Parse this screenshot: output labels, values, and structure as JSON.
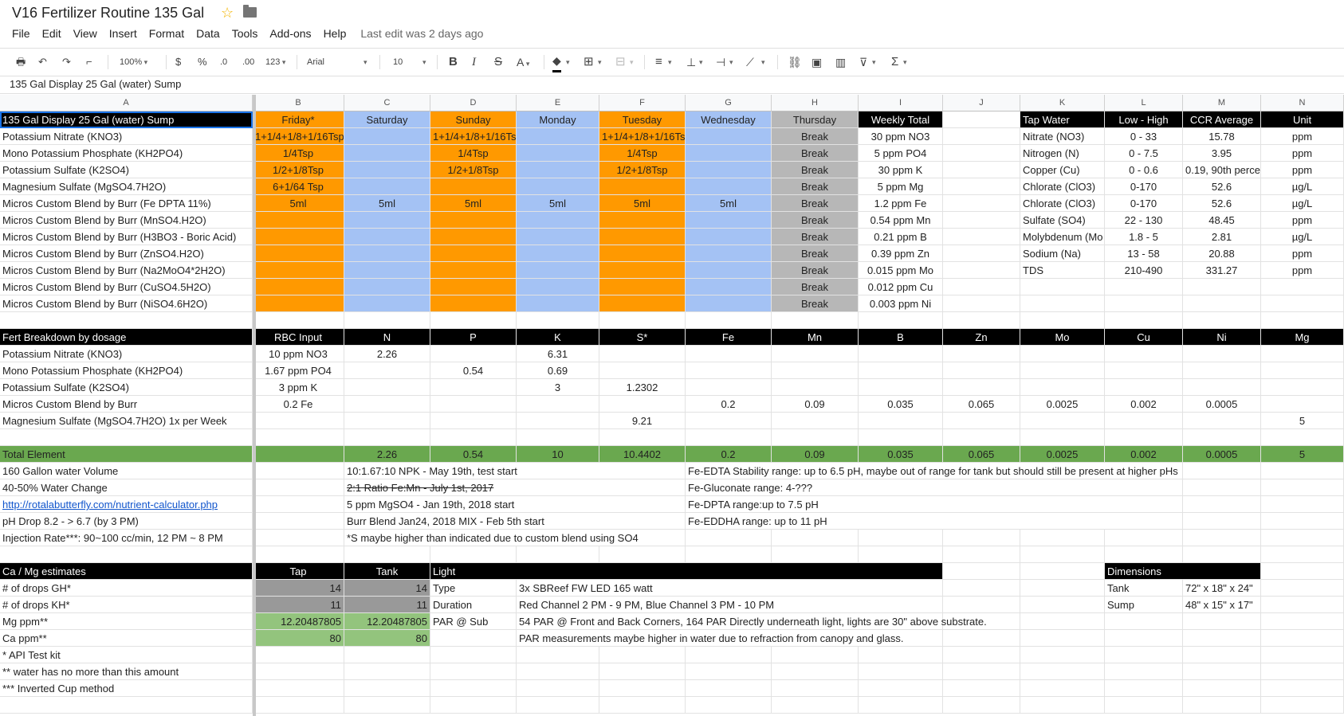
{
  "doc": {
    "title": "V16 Fertilizer Routine 135 Gal",
    "last_edit": "Last edit was 2 days ago"
  },
  "menu": [
    "File",
    "Edit",
    "View",
    "Insert",
    "Format",
    "Data",
    "Tools",
    "Add-ons",
    "Help"
  ],
  "toolbar": {
    "zoom": "100%",
    "currency": "$",
    "percent": "%",
    "dec_less": ".0",
    "dec_more": ".00",
    "format_more": "123",
    "font": "Arial",
    "font_size": "10"
  },
  "formula_bar": "135 Gal Display 25 Gal (water)  Sump",
  "columns": [
    "A",
    "B",
    "C",
    "D",
    "E",
    "F",
    "G",
    "H",
    "I",
    "J",
    "K",
    "L",
    "M",
    "N"
  ],
  "sched": {
    "header": [
      "135 Gal Display 25 Gal (water)  Sump",
      "Friday*",
      "Saturday",
      "Sunday",
      "Monday",
      "Tuesday",
      "Wednesday",
      "Thursday",
      "Weekly Total"
    ],
    "rows": [
      [
        "Potassium Nitrate (KNO3)",
        "1+1/4+1/8+1/16Tsp",
        "",
        "1+1/4+1/8+1/16Tsp",
        "",
        "1+1/4+1/8+1/16Tsp",
        "",
        "Break",
        "30 ppm NO3"
      ],
      [
        "Mono Potassium Phosphate (KH2PO4)",
        "1/4Tsp",
        "",
        "1/4Tsp",
        "",
        "1/4Tsp",
        "",
        "Break",
        "5 ppm PO4"
      ],
      [
        "Potassium Sulfate (K2SO4)",
        "1/2+1/8Tsp",
        "",
        "1/2+1/8Tsp",
        "",
        "1/2+1/8Tsp",
        "",
        "Break",
        "30 ppm K"
      ],
      [
        "Magnesium Sulfate (MgSO4.7H2O)",
        "6+1/64 Tsp",
        "",
        "",
        "",
        "",
        "",
        "Break",
        "5 ppm Mg"
      ],
      [
        "Micros Custom Blend by Burr (Fe DPTA 11%)",
        "5ml",
        "5ml",
        "5ml",
        "5ml",
        "5ml",
        "5ml",
        "Break",
        "1.2 ppm Fe"
      ],
      [
        "Micros Custom Blend by Burr (MnSO4.H2O)",
        "",
        "",
        "",
        "",
        "",
        "",
        "Break",
        "0.54 ppm Mn"
      ],
      [
        "Micros Custom Blend by Burr (H3BO3 - Boric Acid)",
        "",
        "",
        "",
        "",
        "",
        "",
        "Break",
        "0.21 ppm B"
      ],
      [
        "Micros Custom Blend by Burr (ZnSO4.H2O)",
        "",
        "",
        "",
        "",
        "",
        "",
        "Break",
        "0.39 ppm Zn"
      ],
      [
        "Micros Custom Blend by Burr (Na2MoO4*2H2O)",
        "",
        "",
        "",
        "",
        "",
        "",
        "Break",
        "0.015 ppm Mo"
      ],
      [
        "Micros Custom Blend by Burr (CuSO4.5H2O)",
        "",
        "",
        "",
        "",
        "",
        "",
        "Break",
        "0.012 ppm Cu"
      ],
      [
        "Micros Custom Blend by Burr (NiSO4.6H2O)",
        "",
        "",
        "",
        "",
        "",
        "",
        "Break",
        "0.003 ppm Ni"
      ]
    ]
  },
  "tap": {
    "header": [
      "Tap Water",
      "Low - High",
      "CCR Average",
      "Unit"
    ],
    "rows": [
      [
        "Nitrate (NO3)",
        "0 - 33",
        "15.78",
        "ppm"
      ],
      [
        "Nitrogen (N)",
        "0 - 7.5",
        "3.95",
        "ppm"
      ],
      [
        "Copper (Cu)",
        "0 - 0.6",
        "0.19, 90th percer",
        "ppm"
      ],
      [
        "Chlorate (ClO3)",
        "0-170",
        "52.6",
        "µg/L"
      ],
      [
        "Chlorate (ClO3)",
        "0-170",
        "52.6",
        "µg/L"
      ],
      [
        "Sulfate (SO4)",
        "22 - 130",
        "48.45",
        "ppm"
      ],
      [
        "Molybdenum (Mo",
        "1.8 - 5",
        "2.81",
        "µg/L"
      ],
      [
        "Sodium (Na)",
        "13 - 58",
        "20.88",
        "ppm"
      ],
      [
        "TDS",
        "210-490",
        "331.27",
        "ppm"
      ]
    ]
  },
  "fert": {
    "header": [
      "Fert Breakdown by dosage",
      "RBC Input",
      "N",
      "P",
      "K",
      "S*",
      "Fe",
      "Mn",
      "B",
      "Zn",
      "Mo",
      "Cu",
      "Ni",
      "Mg"
    ],
    "rows": [
      [
        "Potassium Nitrate (KNO3)",
        "10 ppm NO3",
        "2.26",
        "",
        "6.31",
        "",
        "",
        "",
        "",
        "",
        "",
        "",
        "",
        ""
      ],
      [
        "Mono Potassium Phosphate (KH2PO4)",
        "1.67 ppm PO4",
        "",
        "0.54",
        "0.69",
        "",
        "",
        "",
        "",
        "",
        "",
        "",
        "",
        ""
      ],
      [
        "Potassium Sulfate (K2SO4)",
        "3 ppm K",
        "",
        "",
        "3",
        "1.2302",
        "",
        "",
        "",
        "",
        "",
        "",
        "",
        ""
      ],
      [
        "Micros Custom Blend by Burr",
        "0.2 Fe",
        "",
        "",
        "",
        "",
        "0.2",
        "0.09",
        "0.035",
        "0.065",
        "0.0025",
        "0.002",
        "0.0005",
        ""
      ],
      [
        "Magnesium Sulfate (MgSO4.7H2O) 1x per Week",
        "",
        "",
        "",
        "",
        "9.21",
        "",
        "",
        "",
        "",
        "",
        "",
        "",
        "5"
      ]
    ],
    "total": [
      "Total Element",
      "",
      "2.26",
      "0.54",
      "10",
      "10.4402",
      "0.2",
      "0.09",
      "0.035",
      "0.065",
      "0.0025",
      "0.002",
      "0.0005",
      "5"
    ]
  },
  "notes": {
    "a": [
      "160 Gallon water Volume",
      "40-50% Water Change",
      "http://rotalabutterfly.com/nutrient-calculator.php",
      "pH Drop 8.2 - > 6.7 (by 3 PM)",
      "Injection Rate***: 90~100 cc/min, 12 PM ~ 8 PM"
    ],
    "c": [
      "10:1.67:10 NPK - May 19th, test start",
      "2:1 Ratio Fe:Mn - July 1st, 2017",
      "5 ppm MgSO4 - Jan 19th, 2018 start",
      "Burr Blend Jan24, 2018 MIX - Feb 5th start",
      "*S maybe higher than indicated due to custom blend using SO4"
    ],
    "g": [
      "Fe-EDTA Stability range: up to 6.5 pH, maybe out of range for tank but should still be present at higher pHs",
      "Fe-Gluconate range: 4-???",
      "Fe-DPTA range:up to 7.5 pH",
      "Fe-EDDHA  range: up to 11 pH"
    ]
  },
  "camg": {
    "header": [
      "Ca / Mg estimates",
      "Tap",
      "Tank"
    ],
    "rows": [
      [
        "# of drops GH*",
        "14",
        "14"
      ],
      [
        "# of drops KH*",
        "11",
        "11"
      ],
      [
        "Mg ppm**",
        "12.20487805",
        "12.20487805"
      ],
      [
        "Ca ppm**",
        "80",
        "80"
      ],
      [
        "* API Test kit",
        "",
        ""
      ],
      [
        "** water has no more than this amount",
        "",
        ""
      ],
      [
        "*** Inverted Cup method",
        "",
        ""
      ]
    ]
  },
  "light": {
    "header": "Light",
    "rows": [
      [
        "Type",
        "3x SBReef FW LED 165 watt"
      ],
      [
        "Duration",
        "Red Channel 2 PM - 9 PM, Blue Channel 3 PM - 10 PM"
      ],
      [
        "PAR @ Sub",
        "54 PAR @ Front and Back Corners, 164 PAR Directly underneath light, lights are 30\" above substrate."
      ],
      [
        "",
        "PAR measurements maybe higher in water due to refraction from canopy and glass."
      ]
    ]
  },
  "dims": {
    "header": "Dimensions",
    "rows": [
      [
        "Tank",
        "72\" x 18\" x 24\""
      ],
      [
        "Sump",
        "48\" x 15\" x 17\""
      ]
    ]
  }
}
